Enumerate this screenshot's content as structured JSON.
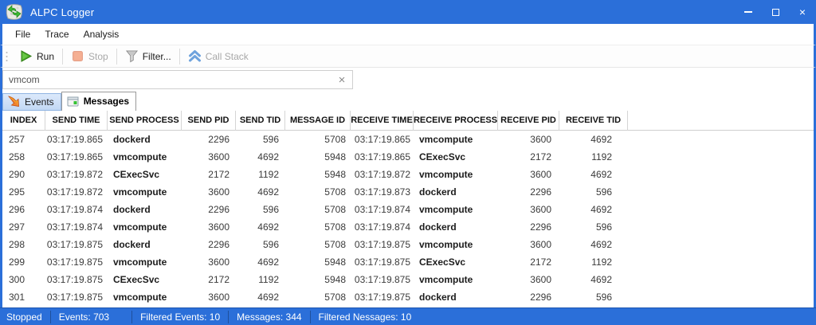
{
  "window": {
    "title": "ALPC Logger"
  },
  "icons": {
    "close": "×"
  },
  "colors": {
    "accent_blue": "#2b6fd9",
    "run_green": "#3fae27",
    "stop_orange": "#ef8a63",
    "callstack_blue": "#5b9bd5",
    "events_arrow_orange": "#e8642c",
    "messages_led_green": "#35c235"
  },
  "menu": {
    "items": [
      {
        "label": "File"
      },
      {
        "label": "Trace"
      },
      {
        "label": "Analysis"
      }
    ]
  },
  "toolbar": {
    "buttons": [
      {
        "label": "Run",
        "enabled": true
      },
      {
        "label": "Stop",
        "enabled": false
      },
      {
        "label": "Filter...",
        "enabled": true
      },
      {
        "label": "Call Stack",
        "enabled": false
      }
    ]
  },
  "search": {
    "value": "vmcom",
    "placeholder": ""
  },
  "tabs": [
    {
      "label": "Events",
      "active": false
    },
    {
      "label": "Messages",
      "active": true
    }
  ],
  "table": {
    "columns": [
      {
        "label": "INDEX"
      },
      {
        "label": "SEND TIME"
      },
      {
        "label": "SEND PROCESS"
      },
      {
        "label": "SEND PID"
      },
      {
        "label": "SEND TID"
      },
      {
        "label": "MESSAGE ID"
      },
      {
        "label": "RECEIVE TIME"
      },
      {
        "label": "RECEIVE PROCESS"
      },
      {
        "label": "RECEIVE PID"
      },
      {
        "label": "RECEIVE TID"
      }
    ],
    "rows": [
      [
        "257",
        "03:17:19.865",
        "dockerd",
        "2296",
        "596",
        "5708",
        "03:17:19.865",
        "vmcompute",
        "3600",
        "4692"
      ],
      [
        "258",
        "03:17:19.865",
        "vmcompute",
        "3600",
        "4692",
        "5948",
        "03:17:19.865",
        "CExecSvc",
        "2172",
        "1192"
      ],
      [
        "290",
        "03:17:19.872",
        "CExecSvc",
        "2172",
        "1192",
        "5948",
        "03:17:19.872",
        "vmcompute",
        "3600",
        "4692"
      ],
      [
        "295",
        "03:17:19.872",
        "vmcompute",
        "3600",
        "4692",
        "5708",
        "03:17:19.873",
        "dockerd",
        "2296",
        "596"
      ],
      [
        "296",
        "03:17:19.874",
        "dockerd",
        "2296",
        "596",
        "5708",
        "03:17:19.874",
        "vmcompute",
        "3600",
        "4692"
      ],
      [
        "297",
        "03:17:19.874",
        "vmcompute",
        "3600",
        "4692",
        "5708",
        "03:17:19.874",
        "dockerd",
        "2296",
        "596"
      ],
      [
        "298",
        "03:17:19.875",
        "dockerd",
        "2296",
        "596",
        "5708",
        "03:17:19.875",
        "vmcompute",
        "3600",
        "4692"
      ],
      [
        "299",
        "03:17:19.875",
        "vmcompute",
        "3600",
        "4692",
        "5948",
        "03:17:19.875",
        "CExecSvc",
        "2172",
        "1192"
      ],
      [
        "300",
        "03:17:19.875",
        "CExecSvc",
        "2172",
        "1192",
        "5948",
        "03:17:19.875",
        "vmcompute",
        "3600",
        "4692"
      ],
      [
        "301",
        "03:17:19.875",
        "vmcompute",
        "3600",
        "4692",
        "5708",
        "03:17:19.875",
        "dockerd",
        "2296",
        "596"
      ]
    ]
  },
  "status": {
    "items": [
      "Stopped",
      "Events: 703",
      "Filtered Events: 10",
      "Messages: 344",
      "Filtered Nessages: 10"
    ]
  }
}
